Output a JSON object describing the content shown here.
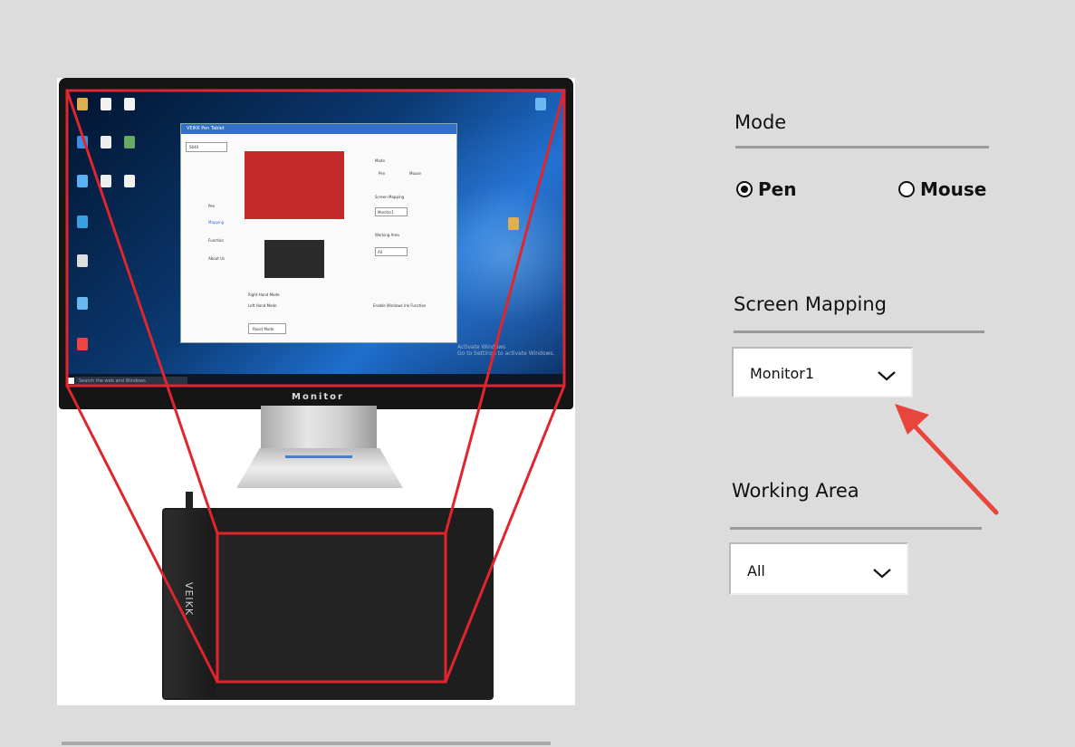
{
  "mode": {
    "title": "Mode",
    "options": [
      {
        "label": "Pen",
        "selected": true
      },
      {
        "label": "Mouse",
        "selected": false
      }
    ]
  },
  "screen_mapping": {
    "title": "Screen Mapping",
    "value": "Monitor1"
  },
  "working_area": {
    "title": "Working Area",
    "value": "All"
  },
  "illustration": {
    "monitor_label": "Monitor",
    "tablet_brand": "VEIKK",
    "taskbar_search": "Search the web and Windows",
    "activate_line1": "Activate Windows",
    "activate_line2": "Go to Settings to activate Windows.",
    "mini_window": {
      "title": "VEIKK Pen Tablet",
      "device": "S640",
      "nav": [
        "Pen",
        "Mapping",
        "Function",
        "About Us"
      ],
      "mode_title": "Mode",
      "pen": "Pen",
      "mouse": "Mouse",
      "screen_mapping": "Screen Mapping",
      "monitor": "Monitor1",
      "working_area": "Working Area",
      "all": "All",
      "right_hand": "Right Hand Mode",
      "left_hand": "Left Hand Mode",
      "ink": "Enable Windows Ink Function",
      "reset": "Reset Mode"
    }
  },
  "colors": {
    "highlight_red": "#e0252c",
    "arrow_red": "#e8453c",
    "background": "#dcdcdc"
  }
}
